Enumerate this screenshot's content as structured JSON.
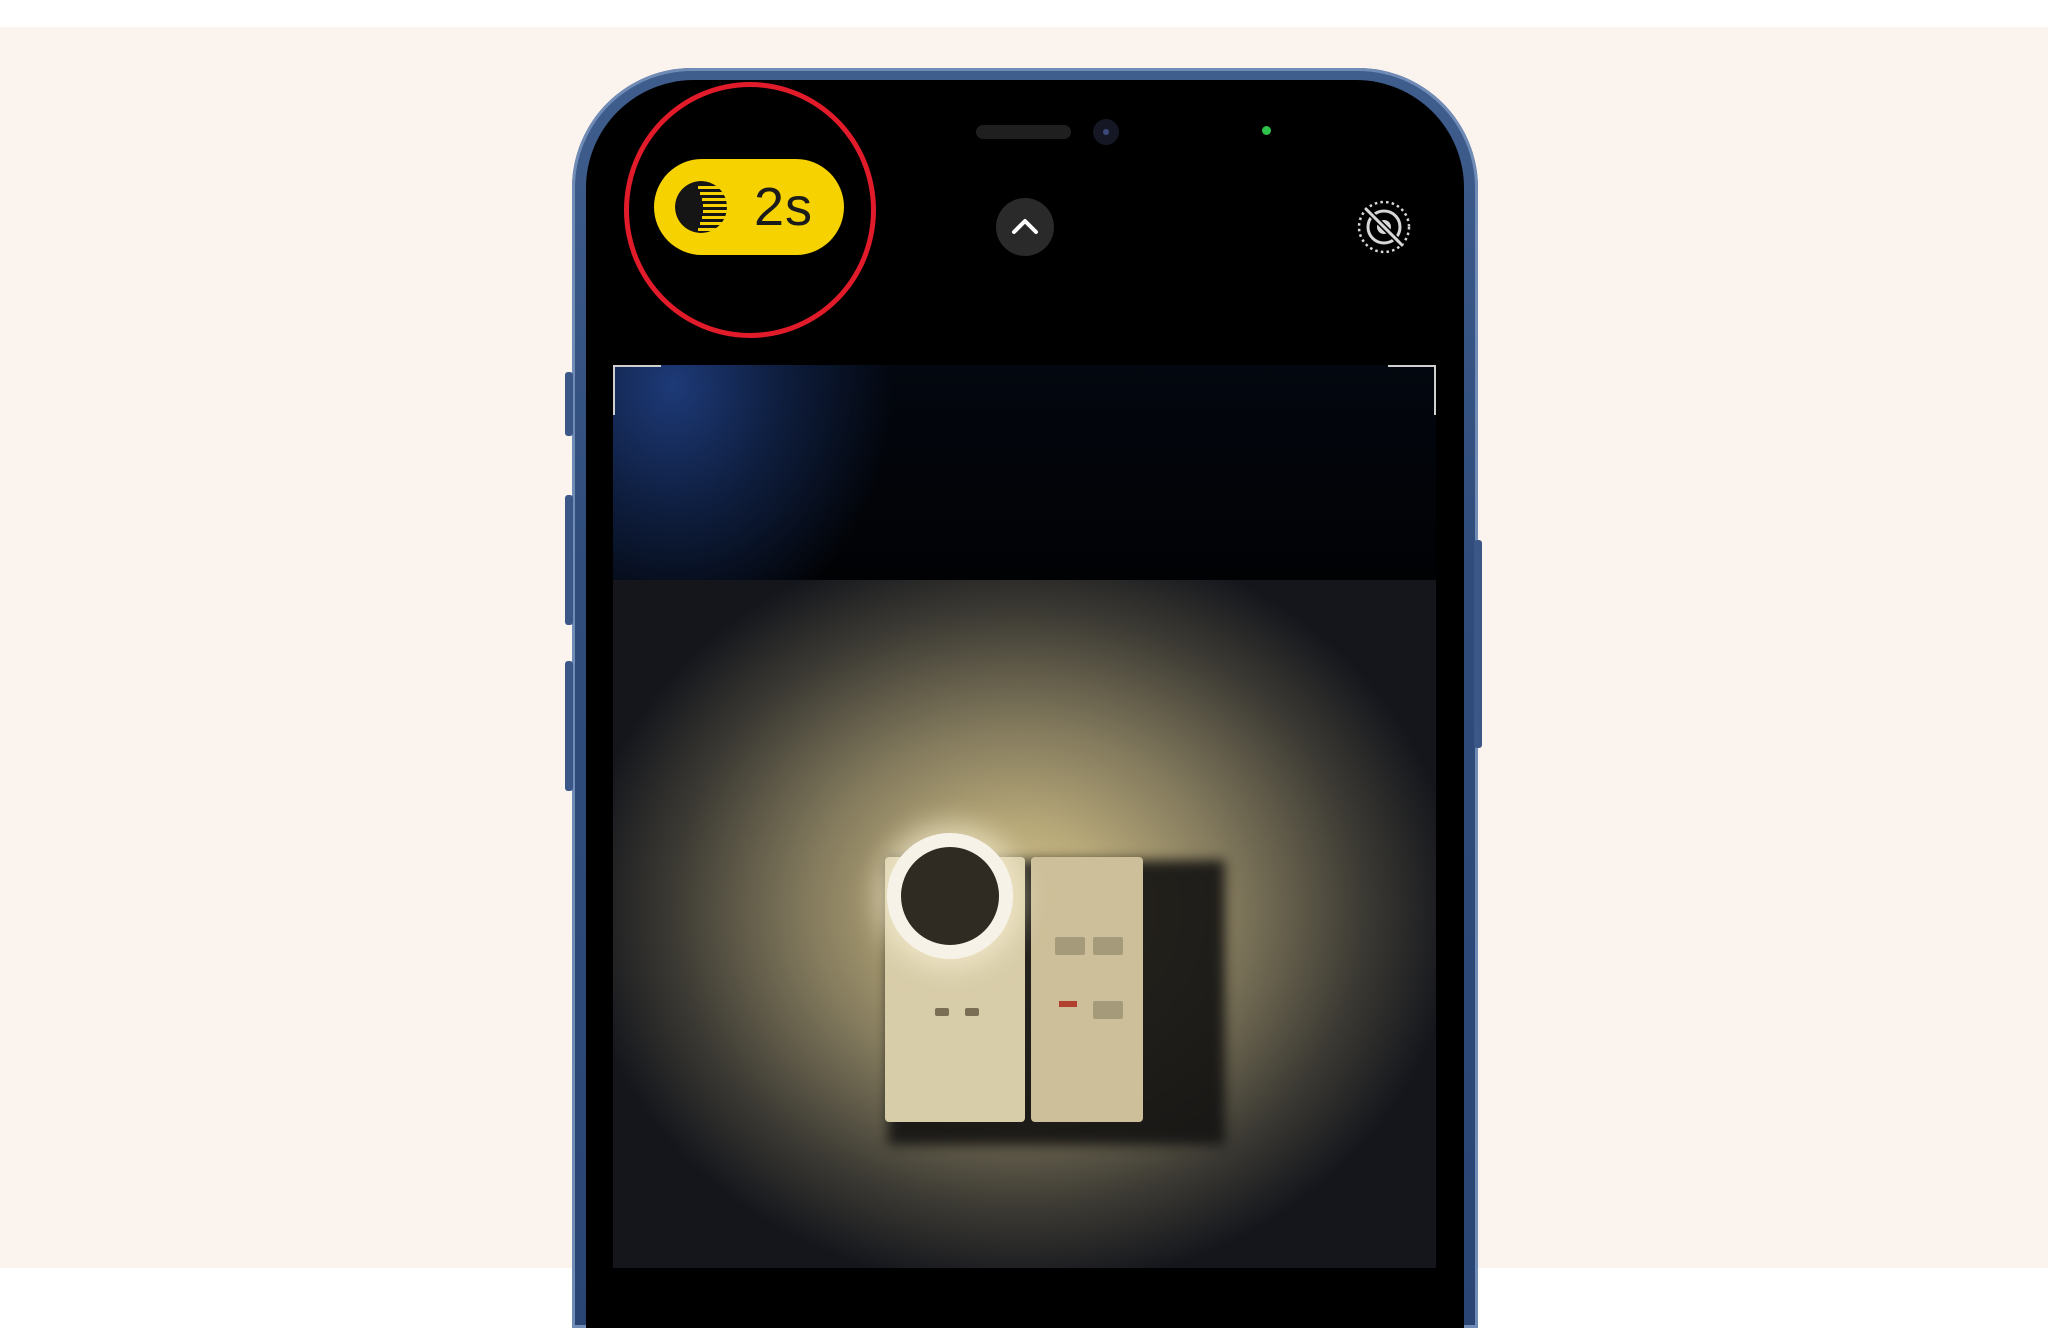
{
  "camera": {
    "night_mode": {
      "label": "2s",
      "icon": "moon-night-mode-icon",
      "color": "#f5d200",
      "highlighted": true,
      "highlight_color": "#e21b2a"
    },
    "expand_controls_icon": "chevron-up-icon",
    "live_photo_icon": "live-photo-off-icon",
    "status_indicator_color": "#2ec24a"
  },
  "device": {
    "frame_color": "#2f4c7b"
  },
  "page": {
    "background_color": "#fbf4ee"
  }
}
